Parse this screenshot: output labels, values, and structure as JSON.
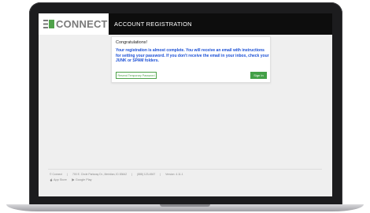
{
  "header": {
    "logo_text": "CONNECT",
    "page_title": "ACCOUNT REGISTRATION"
  },
  "card": {
    "title": "Congratulations!",
    "message": "Your registration is almost complete. You will receive an email with instructions for setting your password.  If you don't receive the email in your inbox, check your JUNK or SPAM folders.",
    "resend_label": "Resend Temporary Password",
    "signin_label": "Sign In"
  },
  "footer": {
    "company": "© Connect",
    "address": "700 E. Circle Parkway Dr., Meridian, ID 83642",
    "phone": "(888) 123-4567",
    "version": "Version: 4.11.1",
    "app_store": "App Store",
    "google_play": "Google Play"
  },
  "colors": {
    "brand_green": "#4fa24a",
    "message_blue": "#1a4fd6",
    "header_bg": "#0d0d0d"
  }
}
